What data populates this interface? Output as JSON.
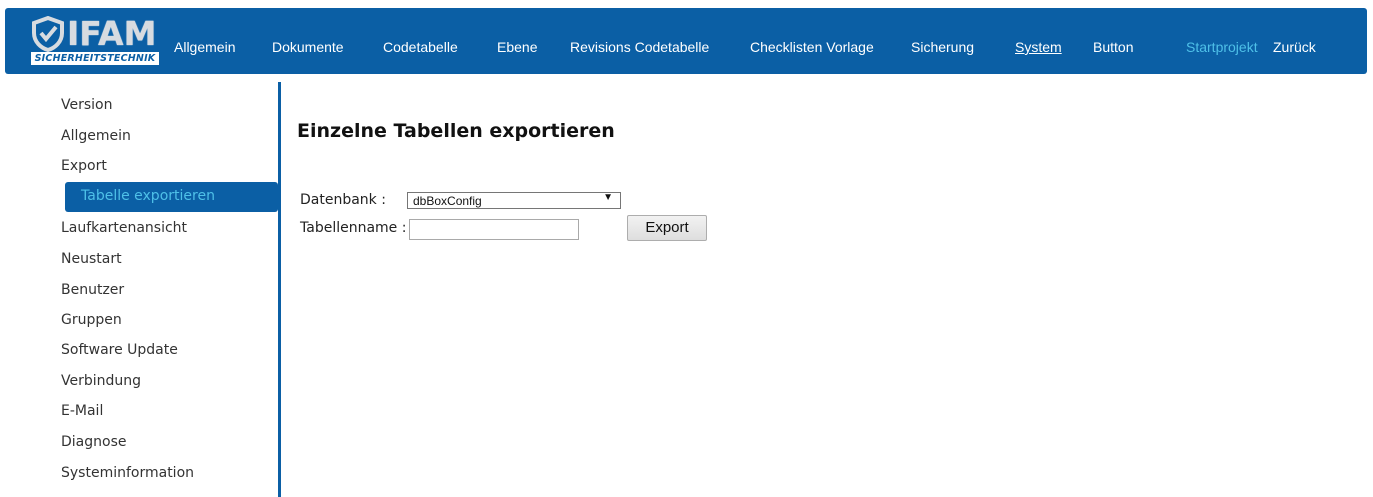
{
  "logo": {
    "wordmark": "IFAM",
    "subtitle": "SICHERHEITSTECHNIK"
  },
  "nav": {
    "items": [
      "Allgemein",
      "Dokumente",
      "Codetabelle",
      "Ebene",
      "Revisions Codetabelle",
      "Checklisten Vorlage",
      "Sicherung",
      "System",
      "Button"
    ],
    "active": "System",
    "project": "Startprojekt",
    "back": "Zurück"
  },
  "sidebar": {
    "items": [
      "Version",
      "Allgemein",
      "Export",
      "Tabelle exportieren",
      "Laufkartenansicht",
      "Neustart",
      "Benutzer",
      "Gruppen",
      "Software Update",
      "Verbindung",
      "E-Mail",
      "Diagnose",
      "Systeminformation"
    ],
    "selected": "Tabelle exportieren"
  },
  "main": {
    "title": "Einzelne Tabellen exportieren",
    "db_label": "Datenbank :",
    "db_value": "dbBoxConfig",
    "table_label": "Tabellenname :",
    "table_value": "",
    "export_button": "Export"
  },
  "colors": {
    "brand": "#0b5fa5",
    "accent": "#4ec0e8"
  }
}
